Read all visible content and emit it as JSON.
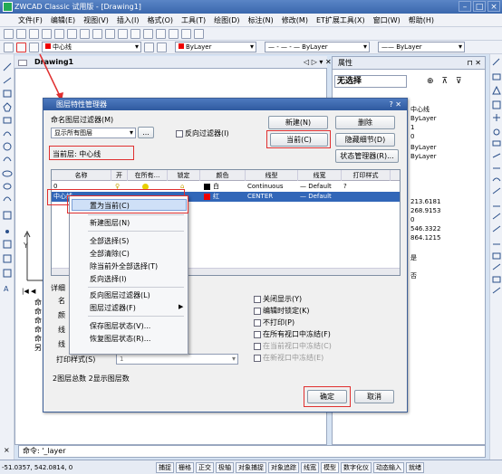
{
  "app": {
    "title": "ZWCAD Classic 试用版 - [Drawing1]"
  },
  "menu": [
    "文件(F)",
    "编辑(E)",
    "视图(V)",
    "插入(I)",
    "格式(O)",
    "工具(T)",
    "绘图(D)",
    "标注(N)",
    "修改(M)",
    "ET扩展工具(X)",
    "窗口(W)",
    "帮助(H)"
  ],
  "toolbar2": {
    "layer_combo": "中心线",
    "color_combo": "ByLayer",
    "linetype_combo": "— - — - — ByLayer",
    "lineweight_combo": "—— ByLayer"
  },
  "doc_tab": "Drawing1",
  "props_panel": {
    "header": "属性",
    "selection": "无选择",
    "values": [
      "中心线",
      "ByLayer",
      "1",
      "0",
      "ByLayer",
      "ByLayer",
      "213.6181",
      "268.9153",
      "0",
      "546.3322",
      "864.1215",
      "是",
      "否"
    ]
  },
  "dialog": {
    "title": "图层特性管理器",
    "filter_label": "命名图层过滤器(M)",
    "filter_value": "显示所有图层",
    "browse_btn": "...",
    "invert_filter": "反向过滤器(I)",
    "current_layer": "当前层: 中心线",
    "btn_new": "新建(N)",
    "btn_delete": "删除",
    "btn_current": "当前(C)",
    "btn_hide": "隐藏细节(D)",
    "btn_state": "状态管理器(R)...",
    "headers": [
      "名称",
      "开",
      "在所有...",
      "锁定",
      "颜色",
      "线型",
      "线宽",
      "打印样式"
    ],
    "rows": [
      {
        "name": "0",
        "color": "白",
        "linetype": "Continuous",
        "lineweight": "— Default",
        "plot": "?"
      },
      {
        "name": "中心线",
        "color": "红",
        "linetype": "CENTER",
        "lineweight": "— Default",
        "plot": ""
      }
    ],
    "detail_label": "详细",
    "plotstyle_label": "打印样式(S)",
    "plotstyle_value": "1",
    "left_labels": [
      "名",
      "颜",
      "线",
      "线"
    ],
    "checks": [
      "关闭显示(Y)",
      "编辑时锁定(K)",
      "不打印(P)",
      "在所有视口中冻结(F)",
      "在当前视口中冻结(C)",
      "在新视口中冻结(E)"
    ],
    "summary": "2图层总数    2显示图层数",
    "btn_ok": "确定",
    "btn_cancel": "取消"
  },
  "context_menu": [
    "置为当前(C)",
    "新建图层(N)",
    "全部选择(S)",
    "全部清除(C)",
    "除当前外全部选择(T)",
    "反向选择(I)",
    "反向图层过滤器(L)",
    "图层过滤器(F)",
    "保存图层状态(V)...",
    "恢复图层状态(R)..."
  ],
  "side_text": [
    "命",
    "命",
    "命",
    "命",
    "命",
    "另"
  ],
  "command": {
    "text": "命令: '_layer"
  },
  "status": {
    "coords": "-51.0357,  542.0814,  0",
    "buttons": [
      "捕捉",
      "栅格",
      "正交",
      "极轴",
      "对象捕捉",
      "对象追踪",
      "线宽",
      "模型",
      "数字化仪",
      "动态输入",
      "就绪"
    ]
  }
}
